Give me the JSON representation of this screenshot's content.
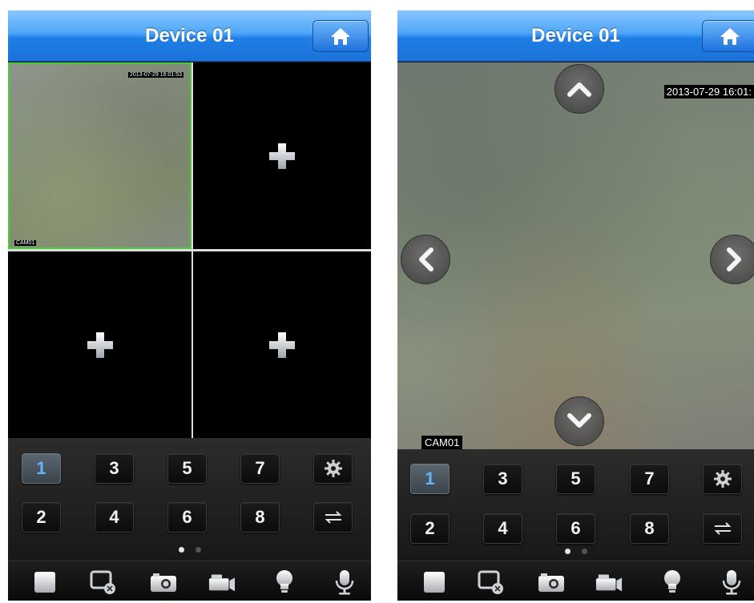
{
  "left_screen": {
    "title": "Device 01",
    "home_icon": "home-icon",
    "tiles": [
      {
        "state": "live",
        "timestamp": "2013-07-29 16:01:53",
        "camera": "CAM01"
      },
      {
        "state": "empty",
        "icon": "plus-icon"
      },
      {
        "state": "empty",
        "icon": "plus-icon"
      },
      {
        "state": "empty",
        "icon": "plus-icon"
      }
    ],
    "channel_keys_row1": [
      "1",
      "3",
      "5",
      "7"
    ],
    "channel_keys_row2": [
      "2",
      "4",
      "6",
      "8"
    ],
    "active_channel": "1",
    "page_dots": {
      "count": 2,
      "current": 0
    }
  },
  "right_screen": {
    "title": "Device 01",
    "home_icon": "home-icon",
    "timestamp": "2013-07-29 16:01:",
    "camera": "CAM01",
    "ptz": [
      "up-arrow-icon",
      "down-arrow-icon",
      "left-arrow-icon",
      "right-arrow-icon"
    ],
    "channel_keys_row1": [
      "1",
      "3",
      "5",
      "7"
    ],
    "channel_keys_row2": [
      "2",
      "4",
      "6",
      "8"
    ],
    "active_channel": "1",
    "page_dots": {
      "count": 2,
      "current": 0
    }
  },
  "side_keys": [
    "settings-gear-icon",
    "swap-arrows-icon"
  ],
  "toolbar": [
    "stop-icon",
    "close-video-icon",
    "snapshot-camera-icon",
    "record-video-icon",
    "light-bulb-icon",
    "microphone-icon"
  ],
  "colors": {
    "nav_blue": "#2f8cf0",
    "selected_border": "#4ccb3e",
    "active_key_text": "#5fb8ff"
  }
}
